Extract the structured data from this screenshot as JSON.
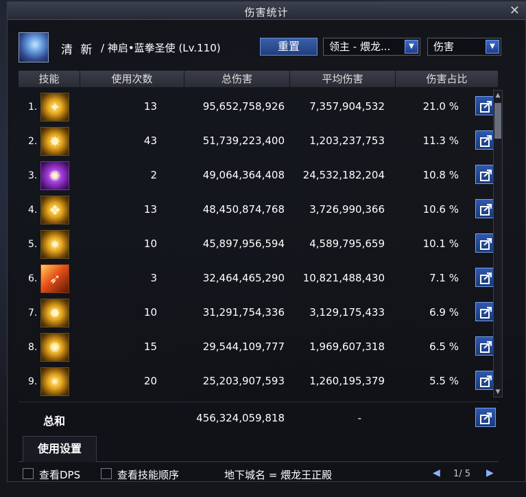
{
  "window": {
    "title": "伤害统计",
    "close_glyph": "✕"
  },
  "header": {
    "character_name": "清 新",
    "character_class": "/ 神启•蓝拳圣使 (Lv.110)",
    "reset_label": "重置",
    "boss_select": "领主 - 煨龙...",
    "type_select": "伤害"
  },
  "columns": {
    "skill": "技能",
    "count": "使用次数",
    "total": "总伤害",
    "avg": "平均伤害",
    "pct": "伤害占比"
  },
  "rows": [
    {
      "rank": "1.",
      "count": "13",
      "total": "95,652,758,926",
      "avg": "7,357,904,532",
      "pct": "21.0 %",
      "icon": "skill-1-icon",
      "style": "gold"
    },
    {
      "rank": "2.",
      "count": "43",
      "total": "51,739,223,400",
      "avg": "1,203,237,753",
      "pct": "11.3 %",
      "icon": "skill-2-icon",
      "style": "gold"
    },
    {
      "rank": "3.",
      "count": "2",
      "total": "49,064,364,408",
      "avg": "24,532,182,204",
      "pct": "10.8 %",
      "icon": "skill-3-icon",
      "style": "purple"
    },
    {
      "rank": "4.",
      "count": "13",
      "total": "48,450,874,768",
      "avg": "3,726,990,366",
      "pct": "10.6 %",
      "icon": "skill-4-icon",
      "style": "gold"
    },
    {
      "rank": "5.",
      "count": "10",
      "total": "45,897,956,594",
      "avg": "4,589,795,659",
      "pct": "10.1 %",
      "icon": "skill-5-icon",
      "style": "gold"
    },
    {
      "rank": "6.",
      "count": "3",
      "total": "32,464,465,290",
      "avg": "10,821,488,430",
      "pct": "7.1 %",
      "icon": "skill-6-icon",
      "style": "red"
    },
    {
      "rank": "7.",
      "count": "10",
      "total": "31,291,754,336",
      "avg": "3,129,175,433",
      "pct": "6.9 %",
      "icon": "skill-7-icon",
      "style": "gold"
    },
    {
      "rank": "8.",
      "count": "15",
      "total": "29,544,109,777",
      "avg": "1,969,607,318",
      "pct": "6.5 %",
      "icon": "skill-8-icon",
      "style": "gold"
    },
    {
      "rank": "9.",
      "count": "20",
      "total": "25,203,907,593",
      "avg": "1,260,195,379",
      "pct": "5.5 %",
      "icon": "skill-9-icon",
      "style": "gold"
    }
  ],
  "summary": {
    "label": "总和",
    "total": "456,324,059,818",
    "avg": "-"
  },
  "tabs": {
    "usage_settings": "使用设置"
  },
  "footer": {
    "view_dps": "查看DPS",
    "view_skill_order": "查看技能顺序",
    "dungeon": "地下城名 = 煨龙王正殿",
    "page": "1/ 5"
  },
  "colors": {
    "accent_blue": "#2e58ae",
    "header_bg": "#3b3e4a"
  }
}
